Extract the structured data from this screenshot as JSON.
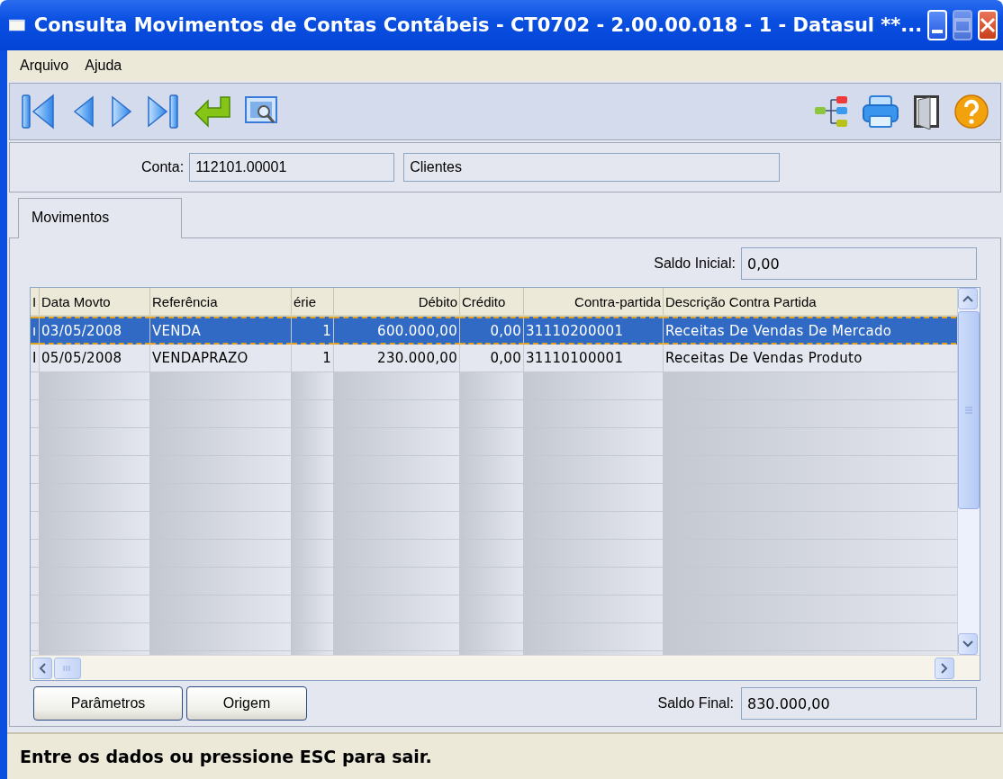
{
  "window": {
    "title": "Consulta Movimentos de Contas Contábeis - CT0702 - 2.00.00.018 - 1 - Datasul **..."
  },
  "menu": [
    "Arquivo",
    "Ajuda"
  ],
  "account": {
    "label": "Conta:",
    "code": "112101.00001",
    "description": "Clientes"
  },
  "tabs": [
    {
      "label": "Movimentos",
      "selected": true
    }
  ],
  "saldo_inicial": {
    "label": "Saldo Inicial:",
    "value": "0,00"
  },
  "table": {
    "columns": [
      "I",
      "Data Movto",
      "Referência",
      "érie",
      "Débito",
      "Crédito",
      "Contra-partida",
      "Descrição Contra Partida"
    ],
    "rows": [
      {
        "selected": true,
        "cells": [
          "ı",
          "03/05/2008",
          "VENDA",
          "1",
          "600.000,00",
          "0,00",
          "31110200001",
          "Receitas De Vendas De Mercado"
        ]
      },
      {
        "selected": false,
        "cells": [
          "I",
          "05/05/2008",
          "VENDAPRAZO",
          "1",
          "230.000,00",
          "0,00",
          "31110100001",
          "Receitas De Vendas Produto"
        ]
      }
    ]
  },
  "buttons": [
    "Parâmetros",
    "Origem"
  ],
  "saldo_final": {
    "label": "Saldo Final:",
    "value": "830.000,00"
  },
  "status_bar": "Entre os dados ou pressione ESC para sair."
}
